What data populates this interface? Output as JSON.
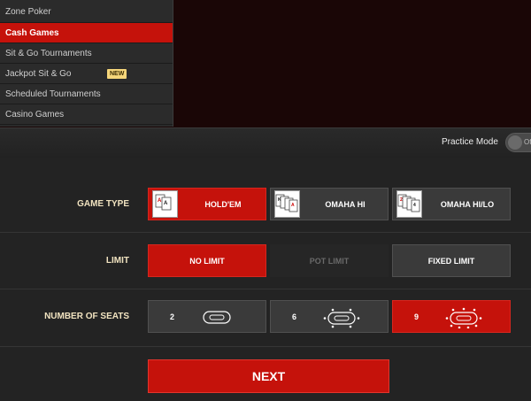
{
  "menu": {
    "items": [
      {
        "label": "Zone Poker",
        "active": false
      },
      {
        "label": "Cash Games",
        "active": true
      },
      {
        "label": "Sit & Go Tournaments",
        "active": false
      },
      {
        "label": "Jackpot Sit & Go",
        "active": false,
        "badge": "NEW"
      },
      {
        "label": "Scheduled Tournaments",
        "active": false
      },
      {
        "label": "Casino Games",
        "active": false
      }
    ]
  },
  "practice": {
    "label": "Practice Mode",
    "toggle_text": "Off",
    "enabled": false
  },
  "game_type": {
    "label": "GAME TYPE",
    "options": [
      {
        "label": "HOLD'EM",
        "selected": true,
        "icon": "holdem-cards-icon"
      },
      {
        "label": "OMAHA HI",
        "selected": false,
        "icon": "omaha-cards-icon"
      },
      {
        "label": "OMAHA HI/LO",
        "selected": false,
        "icon": "omaha-hilo-cards-icon"
      }
    ]
  },
  "limit": {
    "label": "LIMIT",
    "options": [
      {
        "label": "NO LIMIT",
        "selected": true
      },
      {
        "label": "POT LIMIT",
        "selected": false,
        "disabled": true
      },
      {
        "label": "FIXED LIMIT",
        "selected": false
      }
    ]
  },
  "seats": {
    "label": "NUMBER OF SEATS",
    "options": [
      {
        "label": "2",
        "selected": false
      },
      {
        "label": "6",
        "selected": false
      },
      {
        "label": "9",
        "selected": true
      }
    ]
  },
  "next_label": "NEXT",
  "colors": {
    "accent": "#c5120b",
    "label_text": "#f1e3c0",
    "badge": "#f6d67a"
  }
}
